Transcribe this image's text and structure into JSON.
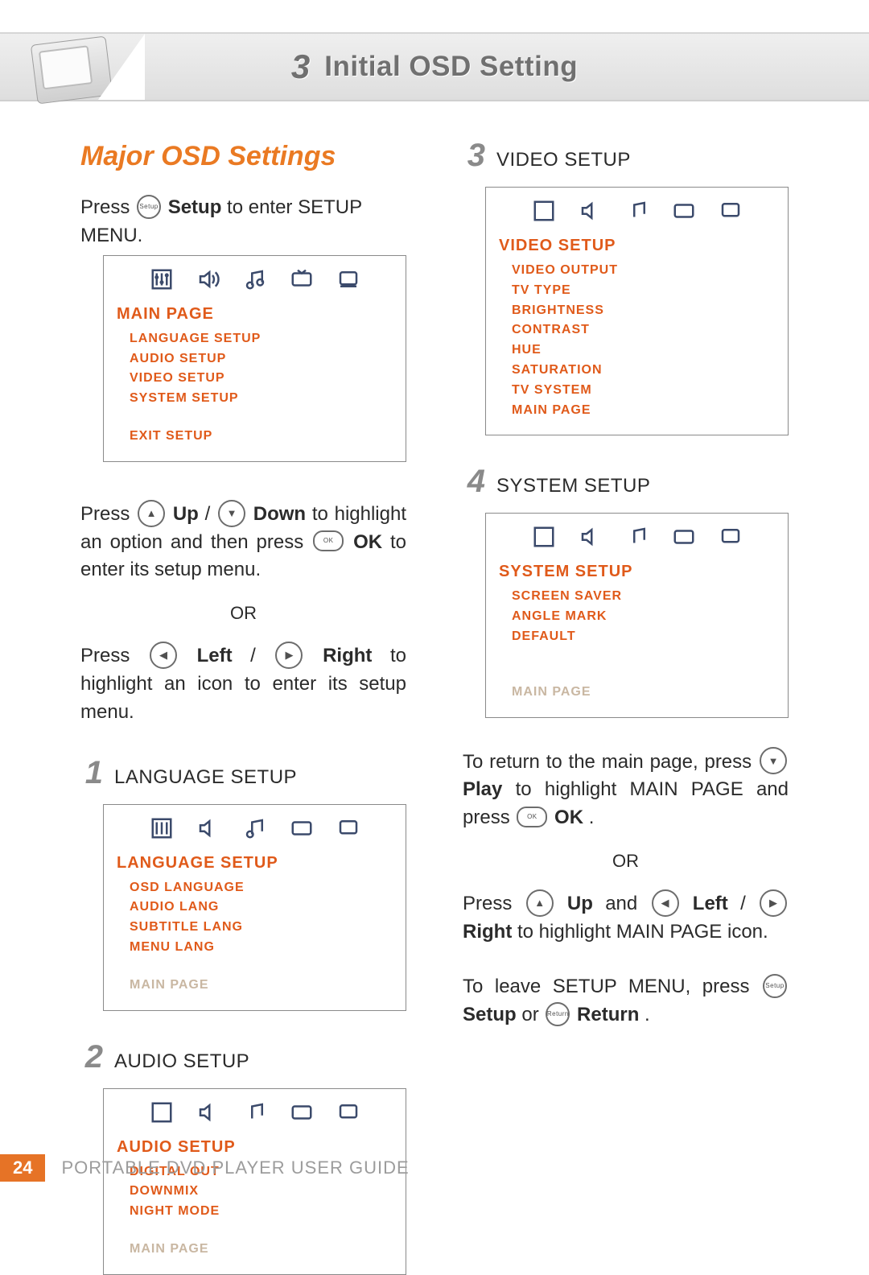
{
  "header": {
    "chapter_number": "3",
    "chapter_title": "Initial OSD Setting"
  },
  "left": {
    "section_title": "Major OSD Settings",
    "para1_a": "Press ",
    "btn_setup": "Setup",
    "para1_b": " Setup",
    "para1_c": " to enter SETUP MENU.",
    "main_page_box": {
      "header": "MAIN PAGE",
      "items": [
        "LANGUAGE SETUP",
        "AUDIO SETUP",
        "VIDEO SETUP",
        "SYSTEM SETUP"
      ],
      "exit": "EXIT SETUP"
    },
    "para2_a": "Press ",
    "btn_up": "Up",
    "para2_b": " / ",
    "btn_down": "Down",
    "para2_c": " to highlight an option and then press ",
    "btn_ok": "OK",
    "para2_d": " to enter its setup menu.",
    "or1": "OR",
    "para3_a": "Press ",
    "btn_left": "Left",
    "para3_b": " / ",
    "btn_right": "Right",
    "para3_c": " to highlight an icon to enter its setup menu.",
    "step1": {
      "num": "1",
      "label": "LANGUAGE SETUP",
      "box": {
        "header": "LANGUAGE SETUP",
        "items": [
          "OSD LANGUAGE",
          "AUDIO LANG",
          "SUBTITLE LANG",
          "MENU LANG"
        ],
        "footer": "MAIN PAGE"
      }
    },
    "step2": {
      "num": "2",
      "label": "AUDIO SETUP",
      "box": {
        "header": "AUDIO SETUP",
        "items": [
          "DIGITAL OUT",
          "DOWNMIX",
          "NIGHT MODE"
        ],
        "footer": "MAIN PAGE"
      }
    }
  },
  "right": {
    "step3": {
      "num": "3",
      "label": "VIDEO SETUP",
      "box": {
        "header": "VIDEO SETUP",
        "items": [
          "VIDEO OUTPUT",
          "TV TYPE",
          "BRIGHTNESS",
          "CONTRAST",
          "HUE",
          "SATURATION",
          "TV SYSTEM",
          "MAIN PAGE"
        ]
      }
    },
    "step4": {
      "num": "4",
      "label": "SYSTEM SETUP",
      "box": {
        "header": "SYSTEM SETUP",
        "items": [
          "SCREEN SAVER",
          "ANGLE MARK",
          "DEFAULT"
        ],
        "footer": "MAIN PAGE"
      }
    },
    "para4_a": "To return to the main page, press ",
    "btn_play": "Play",
    "para4_b": " to highlight MAIN PAGE and press ",
    "para4_c": ".",
    "or2": "OR",
    "para5_a": "Press ",
    "para5_b": " and ",
    "para5_c": " / ",
    "para5_d": " to highlight MAIN PAGE icon.",
    "para6_a": "To leave SETUP MENU, press ",
    "para6_b": " or ",
    "btn_return": "Return",
    "para6_c": "."
  },
  "footer": {
    "page": "24",
    "title": "PORTABLE DVD PLAYER USER GUIDE"
  },
  "labels": {
    "setup": "Setup",
    "up": "Up",
    "down": "Down",
    "ok": "OK",
    "left": "Left",
    "right": "Right",
    "play": "Play",
    "return": "Return"
  }
}
